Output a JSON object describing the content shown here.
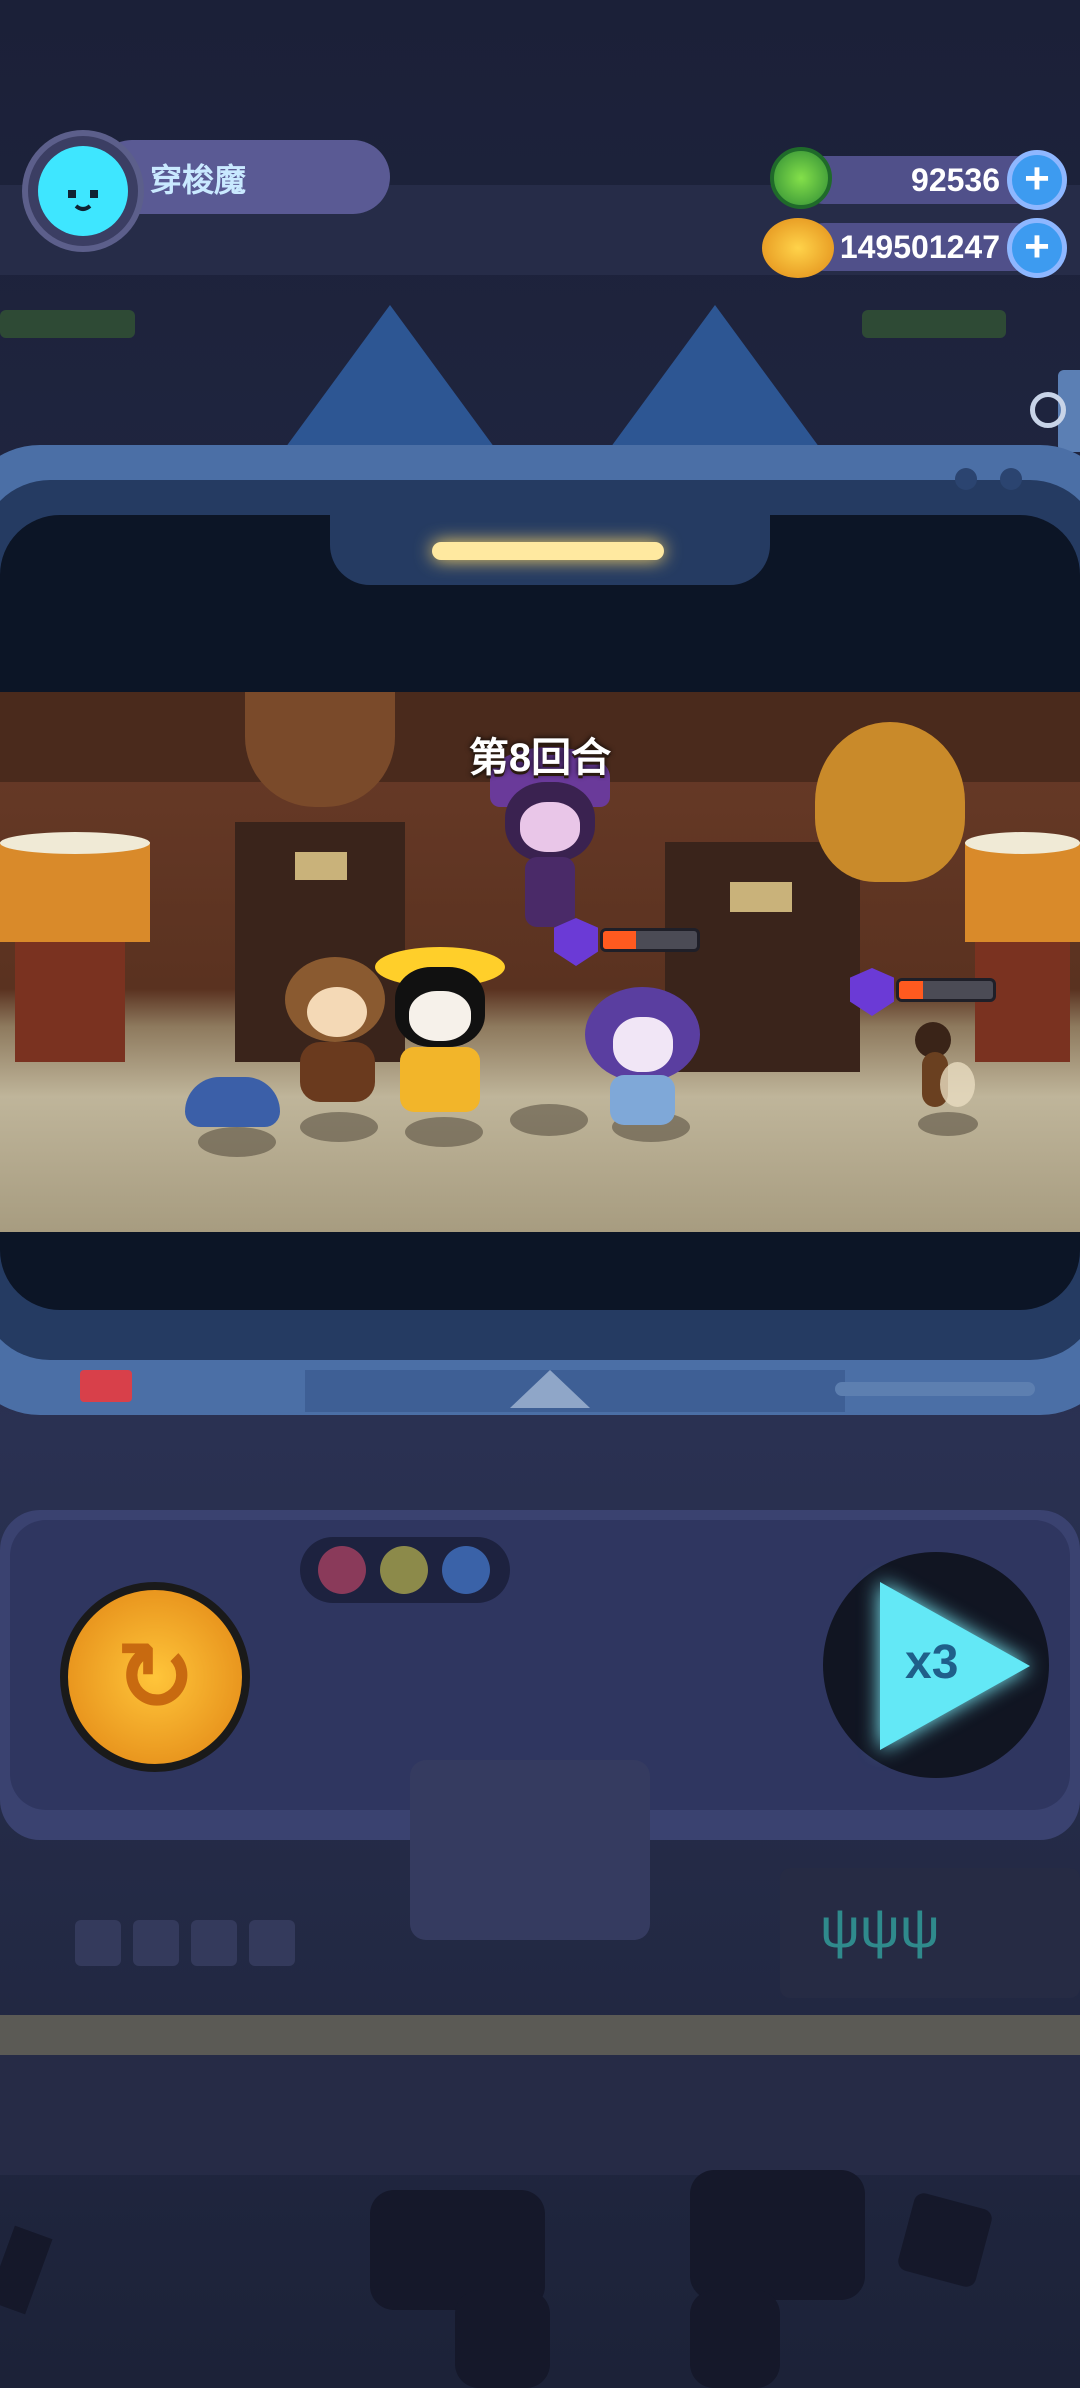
{
  "player": {
    "name": "穿梭魔"
  },
  "currencies": [
    {
      "icon": "green-gem-icon",
      "value": "92536"
    },
    {
      "icon": "gold-planet-coin-icon",
      "value": "149501247"
    }
  ],
  "battle": {
    "round_label": "第8回合",
    "enemy_hp": [
      {
        "unit": "purple-haired-girl",
        "fraction": 0.35
      },
      {
        "unit": "mosquito",
        "fraction": 0.25
      }
    ]
  },
  "controls": {
    "speed_label": "x3",
    "indicator_dots": [
      "#8a3a5a",
      "#8c8a4a",
      "#3a62a8"
    ]
  },
  "colors": {
    "hp_fill": "#ff5a1f",
    "shield": "#6b3ad6",
    "speed_accent": "#63e8f6",
    "retry_accent": "#ffc53a"
  }
}
